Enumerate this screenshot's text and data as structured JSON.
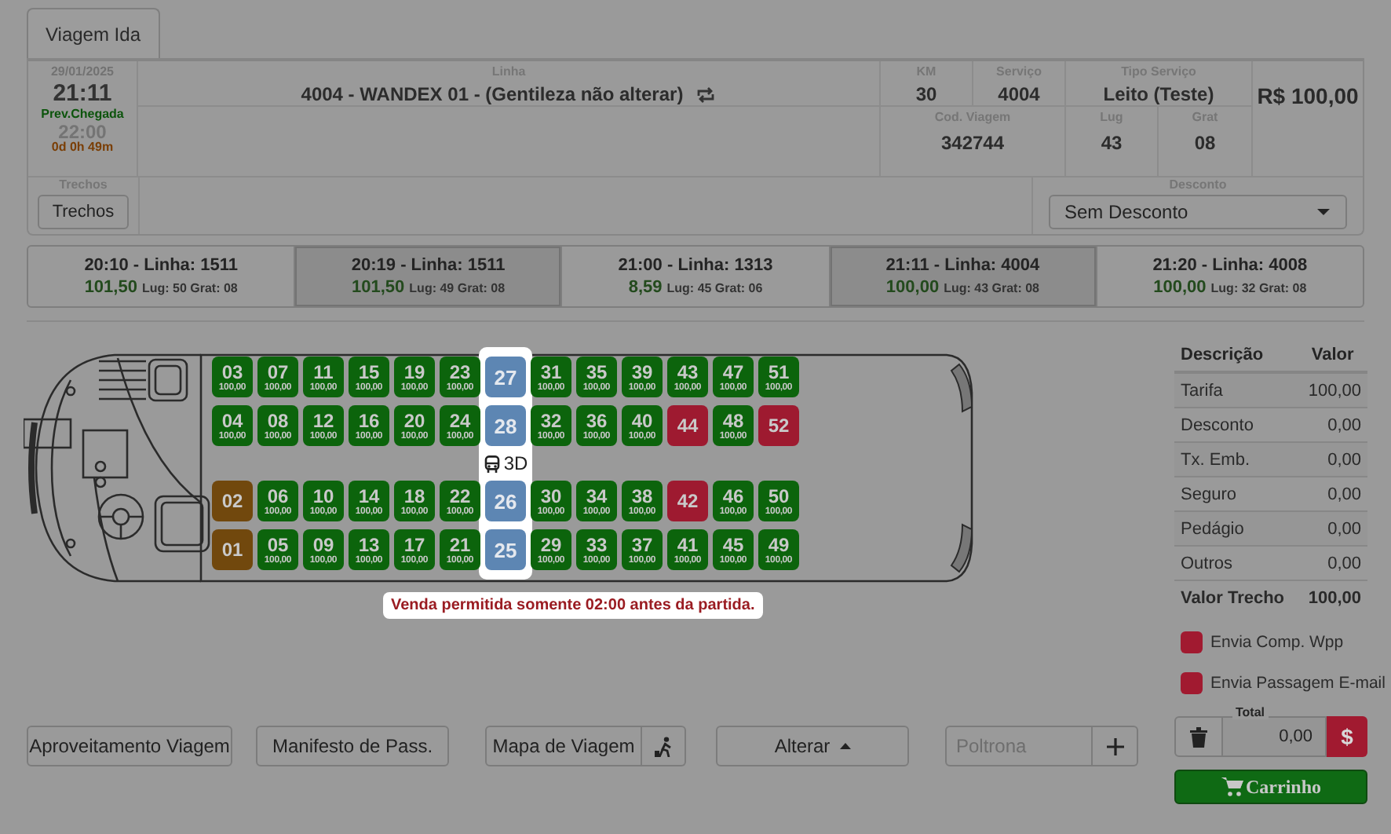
{
  "tabs": [
    {
      "label": "Viagem Ida",
      "selected": true
    }
  ],
  "trip": {
    "date": "29/01/2025",
    "departure": "21:11",
    "arrival_label": "Prev.Chegada",
    "arrival": "22:00",
    "duration": "0d 0h 49m",
    "line_label": "Linha",
    "line": "4004 - WANDEX 01 - (Gentileza não alterar)",
    "price": "R$ 100,00",
    "fields": [
      {
        "label": "KM",
        "value": "30"
      },
      {
        "label": "Serviço",
        "value": "4004"
      },
      {
        "label": "Tipo Serviço",
        "value": "Leito (Teste)"
      },
      {
        "label": "Cod. Viagem",
        "value": "342744"
      },
      {
        "label": "Lug",
        "value": "43"
      },
      {
        "label": "Grat",
        "value": "08"
      }
    ]
  },
  "segments": {
    "label": "Trechos",
    "button": "Trechos"
  },
  "discount": {
    "label": "Desconto",
    "value": "Sem Desconto"
  },
  "departures": [
    {
      "title": "20:10 - Linha: 1511",
      "fare": "101,50",
      "seats_text": "Lug: 50 Grat: 08",
      "selected": false
    },
    {
      "title": "20:19 - Linha: 1511",
      "fare": "101,50",
      "seats_text": "Lug: 49 Grat: 08",
      "selected": true
    },
    {
      "title": "21:00 - Linha: 1313",
      "fare": "8,59",
      "seats_text": "Lug: 45 Grat: 06",
      "selected": false
    },
    {
      "title": "21:11 - Linha: 4004",
      "fare": "100,00",
      "seats_text": "Lug: 43 Grat: 08",
      "selected": true
    },
    {
      "title": "21:20 - Linha: 4008",
      "fare": "100,00",
      "seats_text": "Lug: 32 Grat: 08",
      "selected": false
    }
  ],
  "seat_map": {
    "aisle_label": "3D",
    "notice": "Venda permitida somente 02:00 antes da partida.",
    "rows": [
      [
        {
          "number": "03",
          "price": "100,00",
          "kind": "available"
        },
        {
          "number": "07",
          "price": "100,00",
          "kind": "available"
        },
        {
          "number": "11",
          "price": "100,00",
          "kind": "available"
        },
        {
          "number": "15",
          "price": "100,00",
          "kind": "available"
        },
        {
          "number": "19",
          "price": "100,00",
          "kind": "available"
        },
        {
          "number": "23",
          "price": "100,00",
          "kind": "available"
        },
        {
          "number": "27",
          "kind": "highlighted"
        },
        {
          "number": "31",
          "price": "100,00",
          "kind": "available"
        },
        {
          "number": "35",
          "price": "100,00",
          "kind": "available"
        },
        {
          "number": "39",
          "price": "100,00",
          "kind": "available"
        },
        {
          "number": "43",
          "price": "100,00",
          "kind": "available"
        },
        {
          "number": "47",
          "price": "100,00",
          "kind": "available"
        },
        {
          "number": "51",
          "price": "100,00",
          "kind": "available"
        }
      ],
      [
        {
          "number": "04",
          "price": "100,00",
          "kind": "available"
        },
        {
          "number": "08",
          "price": "100,00",
          "kind": "available"
        },
        {
          "number": "12",
          "price": "100,00",
          "kind": "available"
        },
        {
          "number": "16",
          "price": "100,00",
          "kind": "available"
        },
        {
          "number": "20",
          "price": "100,00",
          "kind": "available"
        },
        {
          "number": "24",
          "price": "100,00",
          "kind": "available"
        },
        {
          "number": "28",
          "kind": "highlighted"
        },
        {
          "number": "32",
          "price": "100,00",
          "kind": "available"
        },
        {
          "number": "36",
          "price": "100,00",
          "kind": "available"
        },
        {
          "number": "40",
          "price": "100,00",
          "kind": "available"
        },
        {
          "number": "44",
          "kind": "sold"
        },
        {
          "number": "48",
          "price": "100,00",
          "kind": "available"
        },
        {
          "number": "52",
          "kind": "sold"
        }
      ],
      [
        {
          "number": "02",
          "kind": "reserved"
        },
        {
          "number": "06",
          "price": "100,00",
          "kind": "available"
        },
        {
          "number": "10",
          "price": "100,00",
          "kind": "available"
        },
        {
          "number": "14",
          "price": "100,00",
          "kind": "available"
        },
        {
          "number": "18",
          "price": "100,00",
          "kind": "available"
        },
        {
          "number": "22",
          "price": "100,00",
          "kind": "available"
        },
        {
          "number": "26",
          "kind": "highlighted"
        },
        {
          "number": "30",
          "price": "100,00",
          "kind": "available"
        },
        {
          "number": "34",
          "price": "100,00",
          "kind": "available"
        },
        {
          "number": "38",
          "price": "100,00",
          "kind": "available"
        },
        {
          "number": "42",
          "kind": "sold"
        },
        {
          "number": "46",
          "price": "100,00",
          "kind": "available"
        },
        {
          "number": "50",
          "price": "100,00",
          "kind": "available"
        }
      ],
      [
        {
          "number": "01",
          "kind": "reserved"
        },
        {
          "number": "05",
          "price": "100,00",
          "kind": "available"
        },
        {
          "number": "09",
          "price": "100,00",
          "kind": "available"
        },
        {
          "number": "13",
          "price": "100,00",
          "kind": "available"
        },
        {
          "number": "17",
          "price": "100,00",
          "kind": "available"
        },
        {
          "number": "21",
          "price": "100,00",
          "kind": "available"
        },
        {
          "number": "25",
          "kind": "highlighted"
        },
        {
          "number": "29",
          "price": "100,00",
          "kind": "available"
        },
        {
          "number": "33",
          "price": "100,00",
          "kind": "available"
        },
        {
          "number": "37",
          "price": "100,00",
          "kind": "available"
        },
        {
          "number": "41",
          "price": "100,00",
          "kind": "available"
        },
        {
          "number": "45",
          "price": "100,00",
          "kind": "available"
        },
        {
          "number": "49",
          "price": "100,00",
          "kind": "available"
        }
      ]
    ]
  },
  "fare_table": {
    "columns": [
      "Descrição",
      "Valor"
    ],
    "rows": [
      {
        "label": "Tarifa",
        "value": "100,00",
        "total": false
      },
      {
        "label": "Desconto",
        "value": "0,00",
        "total": false
      },
      {
        "label": "Tx. Emb.",
        "value": "0,00",
        "total": false
      },
      {
        "label": "Seguro",
        "value": "0,00",
        "total": false
      },
      {
        "label": "Pedágio",
        "value": "0,00",
        "total": false
      },
      {
        "label": "Outros",
        "value": "0,00",
        "total": false
      },
      {
        "label": "Valor Trecho",
        "value": "100,00",
        "total": true
      }
    ]
  },
  "options": [
    {
      "label": "Envia Comp. Wpp",
      "checked": false
    },
    {
      "label": "Envia Passagem E-mail",
      "checked": false
    }
  ],
  "actions": [
    "Aproveitamento Viagem",
    "Manifesto de Pass.",
    "Mapa de Viagem"
  ],
  "alter_button": "Alterar",
  "seat_input": {
    "placeholder": "Poltrona"
  },
  "total": {
    "label": "Total",
    "value": "0,00"
  },
  "pay_button": "$",
  "cart_button": "Carrinho"
}
